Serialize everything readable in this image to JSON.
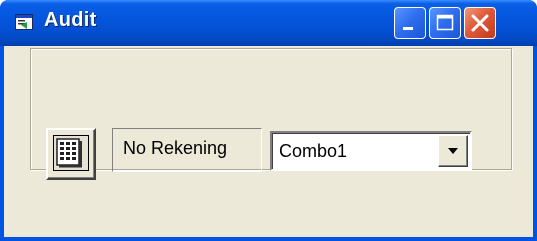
{
  "window": {
    "title": "Audit",
    "icon": "form-window-icon",
    "controls": {
      "minimize": "minimize-icon",
      "maximize": "maximize-icon",
      "close": "close-icon"
    }
  },
  "form": {
    "button_icon": "keypad-icon",
    "label_text": "No Rekening",
    "combo": {
      "value": "Combo1",
      "arrow_icon": "chevron-down-icon"
    }
  },
  "colors": {
    "titlebar": "#0558e0",
    "client_background": "#ece9d8",
    "close_button": "#e0593a"
  }
}
